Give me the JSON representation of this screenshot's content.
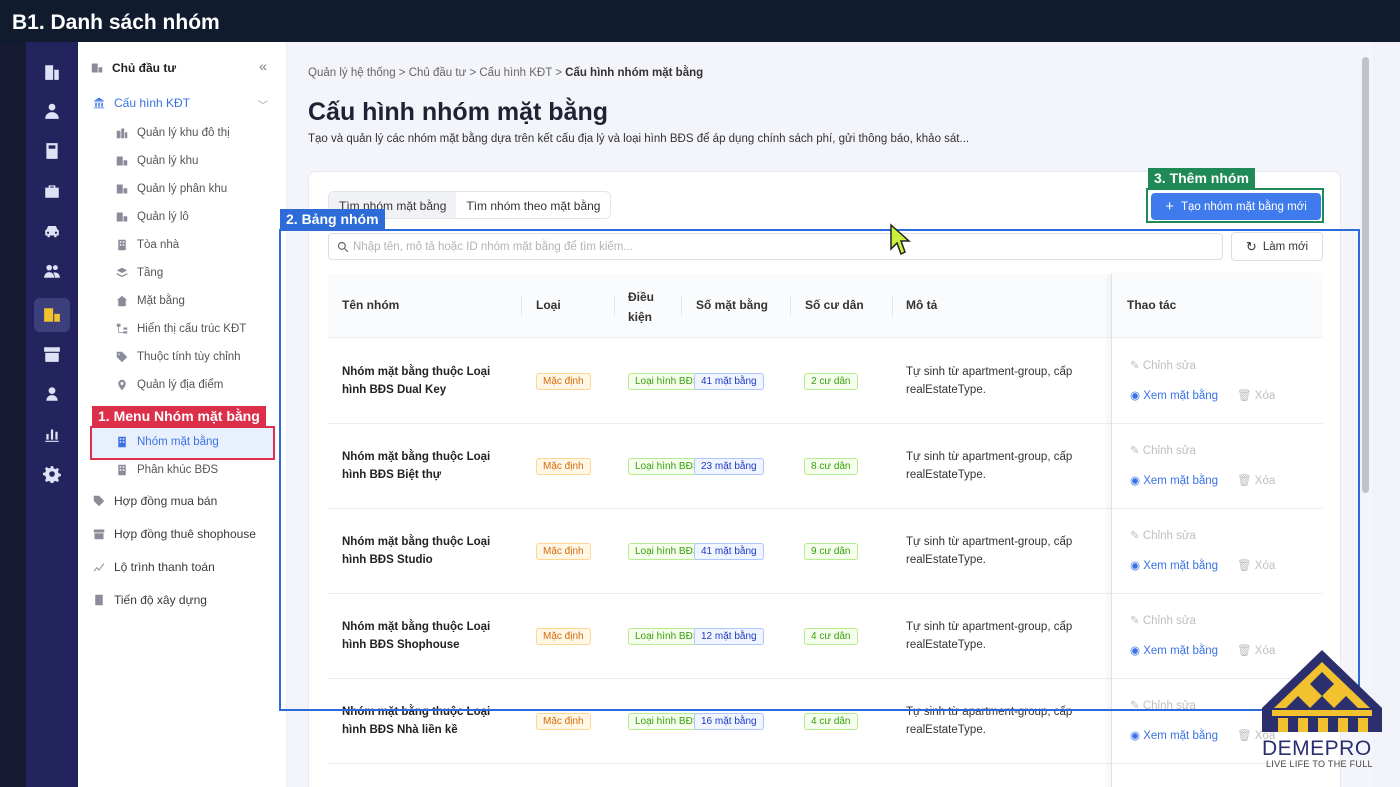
{
  "slide_title": "B1. Danh sách nhóm",
  "sidebar": {
    "top_item": "Chủ đầu tư",
    "config_item": "Cấu hình KĐT",
    "sub_items": [
      "Quản lý khu đô thị",
      "Quản lý khu",
      "Quản lý phân khu",
      "Quản lý lô",
      "Tòa nhà",
      "Tầng",
      "Mặt bằng",
      "Hiển thị cấu trúc KĐT",
      "Thuộc tính tùy chỉnh",
      "Quản lý địa điểm",
      "Nhóm mặt bằng",
      "Phân khúc BĐS"
    ],
    "bottom_items": [
      "Hợp đồng mua bán",
      "Hợp đồng thuê shophouse",
      "Lộ trình thanh toán",
      "Tiến độ xây dựng"
    ],
    "active_item": "Nhóm mặt bằng"
  },
  "breadcrumb": {
    "path": "Quản lý hệ thống > Chủ đầu tư > Cấu hình KĐT > ",
    "current": "Cấu hình nhóm mặt bằng"
  },
  "page": {
    "title": "Cấu hình nhóm mặt bằng",
    "description": "Tạo và quản lý các nhóm mặt bằng dựa trên kết cấu địa lý và loại hình BĐS để áp dụng chính sách phí, gửi thông báo, khảo sát..."
  },
  "tabs": [
    "Tìm nhóm mặt bằng",
    "Tìm nhóm theo mặt bằng"
  ],
  "create_button": "Tạo nhóm mặt bằng mới",
  "search": {
    "placeholder": "Nhập tên, mô tả hoặc ID nhóm mặt bằng để tìm kiếm..."
  },
  "refresh_button": "Làm mới",
  "table": {
    "headers": {
      "name": "Tên nhóm",
      "type": "Loại",
      "condition_1": "Điều",
      "condition_2": "kiện",
      "floors": "Số mặt bằng",
      "residents": "Số cư dân",
      "desc": "Mô tả",
      "actions": "Thao tác"
    },
    "actions": {
      "edit": "Chỉnh sửa",
      "view": "Xem mặt bằng",
      "delete": "Xóa"
    },
    "rows": [
      {
        "name": "Nhóm mặt bằng thuộc Loại hình BĐS Dual Key",
        "type": "Mặc định",
        "condition": "Loại hình BĐS",
        "floors": "41 mặt bằng",
        "residents": "2 cư dân",
        "desc": "Tự sinh từ apartment-group, cấp realEstateType."
      },
      {
        "name": "Nhóm mặt bằng thuộc Loại hình BĐS Biệt thự",
        "type": "Mặc định",
        "condition": "Loại hình BĐS",
        "floors": "23 mặt bằng",
        "residents": "8 cư dân",
        "desc": "Tự sinh từ apartment-group, cấp realEstateType."
      },
      {
        "name": "Nhóm mặt bằng thuộc Loại hình BĐS Studio",
        "type": "Mặc định",
        "condition": "Loại hình BĐS",
        "floors": "41 mặt bằng",
        "residents": "9 cư dân",
        "desc": "Tự sinh từ apartment-group, cấp realEstateType."
      },
      {
        "name": "Nhóm mặt bằng thuộc Loại hình BĐS Shophouse",
        "type": "Mặc định",
        "condition": "Loại hình BĐS",
        "floors": "12 mặt bằng",
        "residents": "4 cư dân",
        "desc": "Tự sinh từ apartment-group, cấp realEstateType."
      },
      {
        "name": "Nhóm mặt bằng thuộc Loại hình BĐS Nhà liền kề",
        "type": "Mặc định",
        "condition": "Loại hình BĐS",
        "floors": "16 mặt bằng",
        "residents": "4 cư dân",
        "desc": "Tự sinh từ apartment-group, cấp realEstateType."
      }
    ]
  },
  "callouts": {
    "menu": {
      "label": "1. Menu Nhóm mặt bằng",
      "color": "#dc2f4a"
    },
    "table": {
      "label": "2. Bảng nhóm",
      "color": "#2d6bd8"
    },
    "add": {
      "label": "3. Thêm nhóm",
      "color": "#1f8a55"
    }
  },
  "logo": {
    "name": "DEMEPRO",
    "tagline": "LIVE LIFE TO THE FULL"
  },
  "colors": {
    "primary": "#3f7bec",
    "rail": "#23235e",
    "topbar": "#111b2e"
  }
}
